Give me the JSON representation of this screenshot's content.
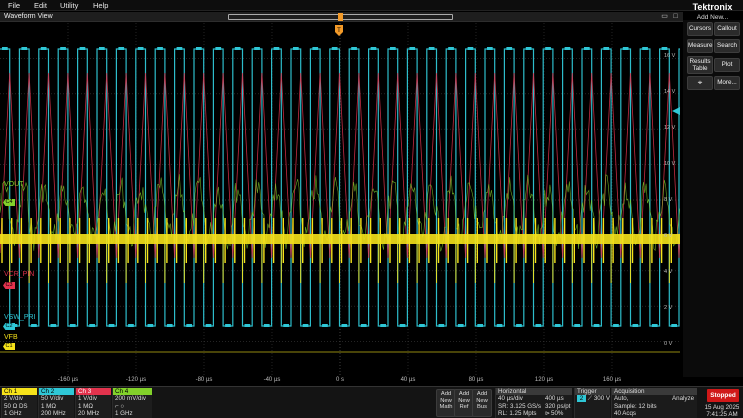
{
  "menu": {
    "file": "File",
    "edit": "Edit",
    "utility": "Utility",
    "help": "Help"
  },
  "brand": {
    "name": "Tektronix",
    "add_new": "Add New..."
  },
  "waveform_view": {
    "title": "Waveform View"
  },
  "right_panel": {
    "cursors": "Cursors",
    "callout": "Callout",
    "measure": "Measure",
    "search": "Search",
    "results_table_1": "Results",
    "results_table_2": "Table",
    "plot": "Plot",
    "more": "More..."
  },
  "trace_labels": {
    "vout": "VOUT",
    "vcr_pin": "VCR_PIN",
    "vsw_pri": "VSW_PRI",
    "vfb": "VFB"
  },
  "trace_tags": {
    "c4": "C4",
    "c3": "C3",
    "c2": "C2",
    "c1": "C1"
  },
  "trigger_marker": "T",
  "x_ticks": [
    "-160 µs",
    "-120 µs",
    "-80 µs",
    "-40 µs",
    "0 s",
    "40 µs",
    "80 µs",
    "120 µs",
    "160 µs"
  ],
  "y_ticks": [
    "16 V",
    "14 V",
    "12 V",
    "10 V",
    "8 V",
    "6 V",
    "4 V",
    "2 V",
    "0 V"
  ],
  "channels": [
    {
      "head": "Ch 1",
      "color": "#f5e21a",
      "l1": "2 V/div",
      "l2": "50 Ω   DS",
      "l3": "1 GHz"
    },
    {
      "head": "Ch 2",
      "color": "#2fc7d6",
      "l1": "50 V/div",
      "l2": "1 MΩ",
      "l3": "200 MHz"
    },
    {
      "head": "Ch 3",
      "color": "#e2334d",
      "l1": "1 V/div",
      "l2": "1 MΩ",
      "l3": "20 MHz"
    },
    {
      "head": "Ch 4",
      "color": "#82d12a",
      "l1": "200 mV/div",
      "l2": "",
      "l3": "1 GHz"
    }
  ],
  "add_new": {
    "math": [
      "Add",
      "New",
      "Math"
    ],
    "ref": [
      "Add",
      "New",
      "Ref"
    ],
    "bus": [
      "Add",
      "New",
      "Bus"
    ]
  },
  "horizontal": {
    "head": "Horizontal",
    "scale": "40 µs/div",
    "record": "400 µs",
    "sr": "SR: 3.125 GS/s",
    "pt": "320 ps/pt",
    "rl": "RL: 1.25 Mpts",
    "pos": "50%"
  },
  "trigger": {
    "head": "Trigger",
    "source": "2",
    "level": "300 V"
  },
  "acquisition": {
    "head": "Acquisition",
    "mode": "Auto,",
    "analyze": "Analyze",
    "sample": "Sample: 12 bits",
    "acqs": "40 Acqs"
  },
  "status": {
    "state": "Stopped",
    "date": "15 Aug 2025",
    "time": "7:41:25 AM"
  },
  "colors": {
    "ch1": "#f5e21a",
    "ch2": "#2fc7d6",
    "ch3": "#e2334d",
    "ch4": "#82d12a",
    "trigger": "#f39a28"
  }
}
